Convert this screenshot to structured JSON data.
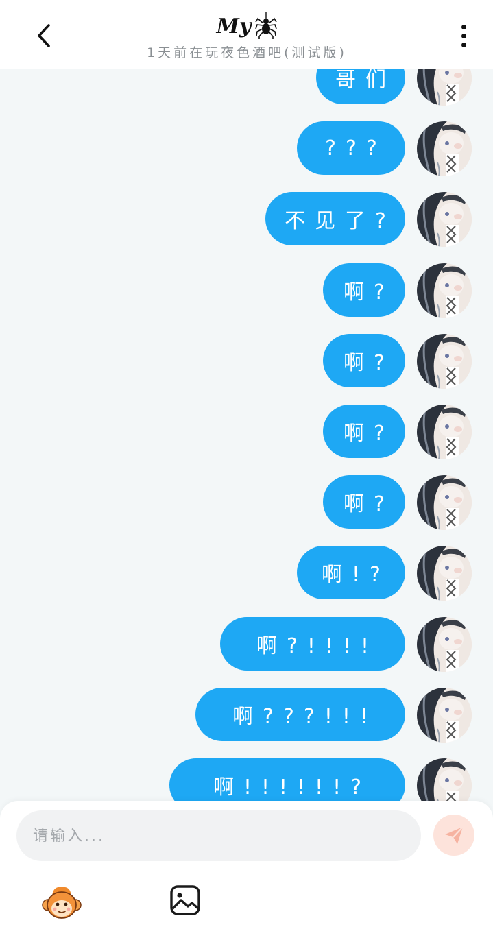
{
  "header": {
    "title": "My",
    "subtitle": "1天前在玩夜色酒吧(测试版)",
    "back_icon": "chevron-left-icon",
    "spider_icon": "spider-icon",
    "more_icon": "more-vertical-icon"
  },
  "messages": [
    {
      "text": "哥们"
    },
    {
      "text": "???"
    },
    {
      "text": "不见了?"
    },
    {
      "text": "啊?"
    },
    {
      "text": "啊?"
    },
    {
      "text": "啊?"
    },
    {
      "text": "啊?"
    },
    {
      "text": "啊!?"
    },
    {
      "text": "啊?!!!!"
    },
    {
      "text": "啊???!!!"
    },
    {
      "text": "啊!!!!!!?"
    }
  ],
  "composer": {
    "placeholder": "请输入...",
    "send_icon": "send-icon",
    "sticker_icon": "monkey-sticker-icon",
    "image_icon": "image-icon"
  },
  "colors": {
    "bubble": "#1ea8f4",
    "send_button": "#fde3db",
    "send_icon": "#f6b3a1",
    "background": "#f3f7f8"
  }
}
